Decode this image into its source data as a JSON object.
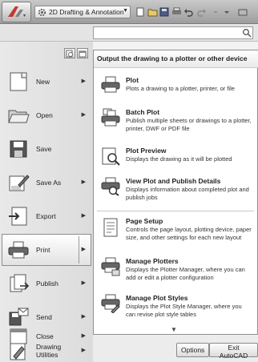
{
  "workspace": {
    "label": "2D Drafting & Annotation"
  },
  "search": {
    "value": "",
    "placeholder": ""
  },
  "left_menu": {
    "items": [
      {
        "label": "New",
        "icon": "new-doc-icon",
        "has_submenu": true
      },
      {
        "label": "Open",
        "icon": "open-folder-icon",
        "has_submenu": true
      },
      {
        "label": "Save",
        "icon": "floppy-disk-icon",
        "has_submenu": false
      },
      {
        "label": "Save As",
        "icon": "save-as-icon",
        "has_submenu": true
      },
      {
        "label": "Export",
        "icon": "export-icon",
        "has_submenu": true
      },
      {
        "label": "Print",
        "icon": "printer-icon",
        "has_submenu": true,
        "active": true
      },
      {
        "label": "Publish",
        "icon": "publish-icon",
        "has_submenu": true
      },
      {
        "label": "Send",
        "icon": "send-icon",
        "has_submenu": true
      },
      {
        "label": "Drawing Utilities",
        "icon": "drawing-utilities-icon",
        "has_submenu": true
      },
      {
        "label": "Close",
        "icon": "close-doc-icon",
        "has_submenu": true
      }
    ]
  },
  "submenu": {
    "header": "Output the drawing to a plotter or other device",
    "items": [
      {
        "title": "Plot",
        "description": "Plots a drawing to a plotter, printer, or file",
        "icon": "plot-printer-icon"
      },
      {
        "title": "Batch Plot",
        "description": "Publish multiple sheets or drawings to a plotter, printer, DWF or PDF file",
        "icon": "batch-plot-icon"
      },
      {
        "title": "Plot Preview",
        "description": "Displays the drawing as it will be plotted",
        "icon": "plot-preview-icon"
      },
      {
        "title": "View Plot and Publish Details",
        "description": "Displays information about completed plot and publish jobs",
        "icon": "plot-details-icon"
      },
      {
        "title": "Page Setup",
        "description": "Controls the page layout, plotting device, paper size, and other settings for each new layout",
        "icon": "page-setup-icon"
      },
      {
        "title": "Manage Plotters",
        "description": "Displays the Plotter Manager, where you can add or edit a plotter configuration",
        "icon": "manage-plotters-icon"
      },
      {
        "title": "Manage Plot Styles",
        "description": "Displays the Plot Style Manager, where you can revise plot style tables",
        "icon": "manage-plot-styles-icon"
      }
    ]
  },
  "footer": {
    "options_label": "Options",
    "exit_label": "Exit AutoCAD"
  },
  "colors": {
    "active_highlight": "#ffffff",
    "title_bar": "#b4b4b4",
    "app_button": "#d23232"
  }
}
